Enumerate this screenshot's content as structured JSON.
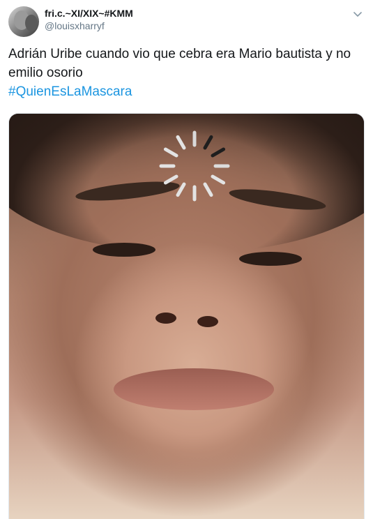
{
  "tweet": {
    "display_name": "fri.c.~XI/XIX~#KMM",
    "handle": "@louisxharryf",
    "text": "Adrián Uribe cuando vio que cebra era Mario bautista y no emilio osorio",
    "hashtag": "#QuienEsLaMascara"
  },
  "icons": {
    "more": "chevron-down-icon",
    "loading": "loading-spinner-icon"
  },
  "colors": {
    "text": "#14171a",
    "secondary": "#657786",
    "link": "#1b95e0"
  }
}
